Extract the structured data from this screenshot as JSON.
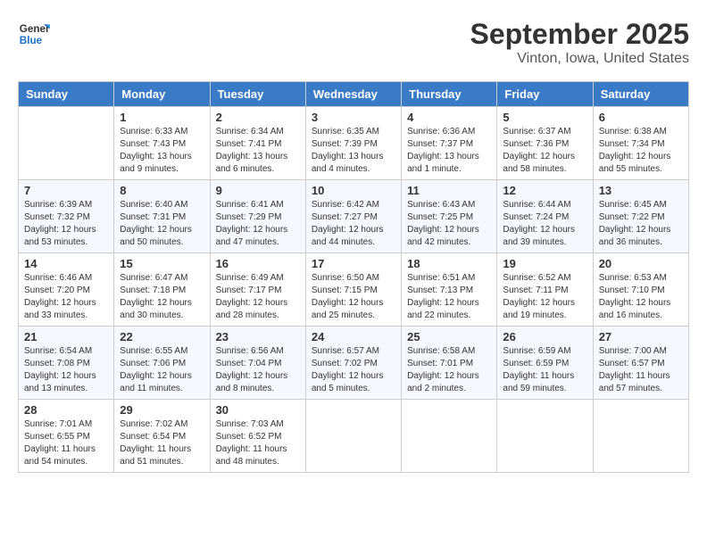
{
  "header": {
    "logo_line1": "General",
    "logo_line2": "Blue",
    "month": "September 2025",
    "location": "Vinton, Iowa, United States"
  },
  "weekdays": [
    "Sunday",
    "Monday",
    "Tuesday",
    "Wednesday",
    "Thursday",
    "Friday",
    "Saturday"
  ],
  "weeks": [
    [
      {
        "day": "",
        "info": ""
      },
      {
        "day": "1",
        "info": "Sunrise: 6:33 AM\nSunset: 7:43 PM\nDaylight: 13 hours\nand 9 minutes."
      },
      {
        "day": "2",
        "info": "Sunrise: 6:34 AM\nSunset: 7:41 PM\nDaylight: 13 hours\nand 6 minutes."
      },
      {
        "day": "3",
        "info": "Sunrise: 6:35 AM\nSunset: 7:39 PM\nDaylight: 13 hours\nand 4 minutes."
      },
      {
        "day": "4",
        "info": "Sunrise: 6:36 AM\nSunset: 7:37 PM\nDaylight: 13 hours\nand 1 minute."
      },
      {
        "day": "5",
        "info": "Sunrise: 6:37 AM\nSunset: 7:36 PM\nDaylight: 12 hours\nand 58 minutes."
      },
      {
        "day": "6",
        "info": "Sunrise: 6:38 AM\nSunset: 7:34 PM\nDaylight: 12 hours\nand 55 minutes."
      }
    ],
    [
      {
        "day": "7",
        "info": "Sunrise: 6:39 AM\nSunset: 7:32 PM\nDaylight: 12 hours\nand 53 minutes."
      },
      {
        "day": "8",
        "info": "Sunrise: 6:40 AM\nSunset: 7:31 PM\nDaylight: 12 hours\nand 50 minutes."
      },
      {
        "day": "9",
        "info": "Sunrise: 6:41 AM\nSunset: 7:29 PM\nDaylight: 12 hours\nand 47 minutes."
      },
      {
        "day": "10",
        "info": "Sunrise: 6:42 AM\nSunset: 7:27 PM\nDaylight: 12 hours\nand 44 minutes."
      },
      {
        "day": "11",
        "info": "Sunrise: 6:43 AM\nSunset: 7:25 PM\nDaylight: 12 hours\nand 42 minutes."
      },
      {
        "day": "12",
        "info": "Sunrise: 6:44 AM\nSunset: 7:24 PM\nDaylight: 12 hours\nand 39 minutes."
      },
      {
        "day": "13",
        "info": "Sunrise: 6:45 AM\nSunset: 7:22 PM\nDaylight: 12 hours\nand 36 minutes."
      }
    ],
    [
      {
        "day": "14",
        "info": "Sunrise: 6:46 AM\nSunset: 7:20 PM\nDaylight: 12 hours\nand 33 minutes."
      },
      {
        "day": "15",
        "info": "Sunrise: 6:47 AM\nSunset: 7:18 PM\nDaylight: 12 hours\nand 30 minutes."
      },
      {
        "day": "16",
        "info": "Sunrise: 6:49 AM\nSunset: 7:17 PM\nDaylight: 12 hours\nand 28 minutes."
      },
      {
        "day": "17",
        "info": "Sunrise: 6:50 AM\nSunset: 7:15 PM\nDaylight: 12 hours\nand 25 minutes."
      },
      {
        "day": "18",
        "info": "Sunrise: 6:51 AM\nSunset: 7:13 PM\nDaylight: 12 hours\nand 22 minutes."
      },
      {
        "day": "19",
        "info": "Sunrise: 6:52 AM\nSunset: 7:11 PM\nDaylight: 12 hours\nand 19 minutes."
      },
      {
        "day": "20",
        "info": "Sunrise: 6:53 AM\nSunset: 7:10 PM\nDaylight: 12 hours\nand 16 minutes."
      }
    ],
    [
      {
        "day": "21",
        "info": "Sunrise: 6:54 AM\nSunset: 7:08 PM\nDaylight: 12 hours\nand 13 minutes."
      },
      {
        "day": "22",
        "info": "Sunrise: 6:55 AM\nSunset: 7:06 PM\nDaylight: 12 hours\nand 11 minutes."
      },
      {
        "day": "23",
        "info": "Sunrise: 6:56 AM\nSunset: 7:04 PM\nDaylight: 12 hours\nand 8 minutes."
      },
      {
        "day": "24",
        "info": "Sunrise: 6:57 AM\nSunset: 7:02 PM\nDaylight: 12 hours\nand 5 minutes."
      },
      {
        "day": "25",
        "info": "Sunrise: 6:58 AM\nSunset: 7:01 PM\nDaylight: 12 hours\nand 2 minutes."
      },
      {
        "day": "26",
        "info": "Sunrise: 6:59 AM\nSunset: 6:59 PM\nDaylight: 11 hours\nand 59 minutes."
      },
      {
        "day": "27",
        "info": "Sunrise: 7:00 AM\nSunset: 6:57 PM\nDaylight: 11 hours\nand 57 minutes."
      }
    ],
    [
      {
        "day": "28",
        "info": "Sunrise: 7:01 AM\nSunset: 6:55 PM\nDaylight: 11 hours\nand 54 minutes."
      },
      {
        "day": "29",
        "info": "Sunrise: 7:02 AM\nSunset: 6:54 PM\nDaylight: 11 hours\nand 51 minutes."
      },
      {
        "day": "30",
        "info": "Sunrise: 7:03 AM\nSunset: 6:52 PM\nDaylight: 11 hours\nand 48 minutes."
      },
      {
        "day": "",
        "info": ""
      },
      {
        "day": "",
        "info": ""
      },
      {
        "day": "",
        "info": ""
      },
      {
        "day": "",
        "info": ""
      }
    ]
  ]
}
